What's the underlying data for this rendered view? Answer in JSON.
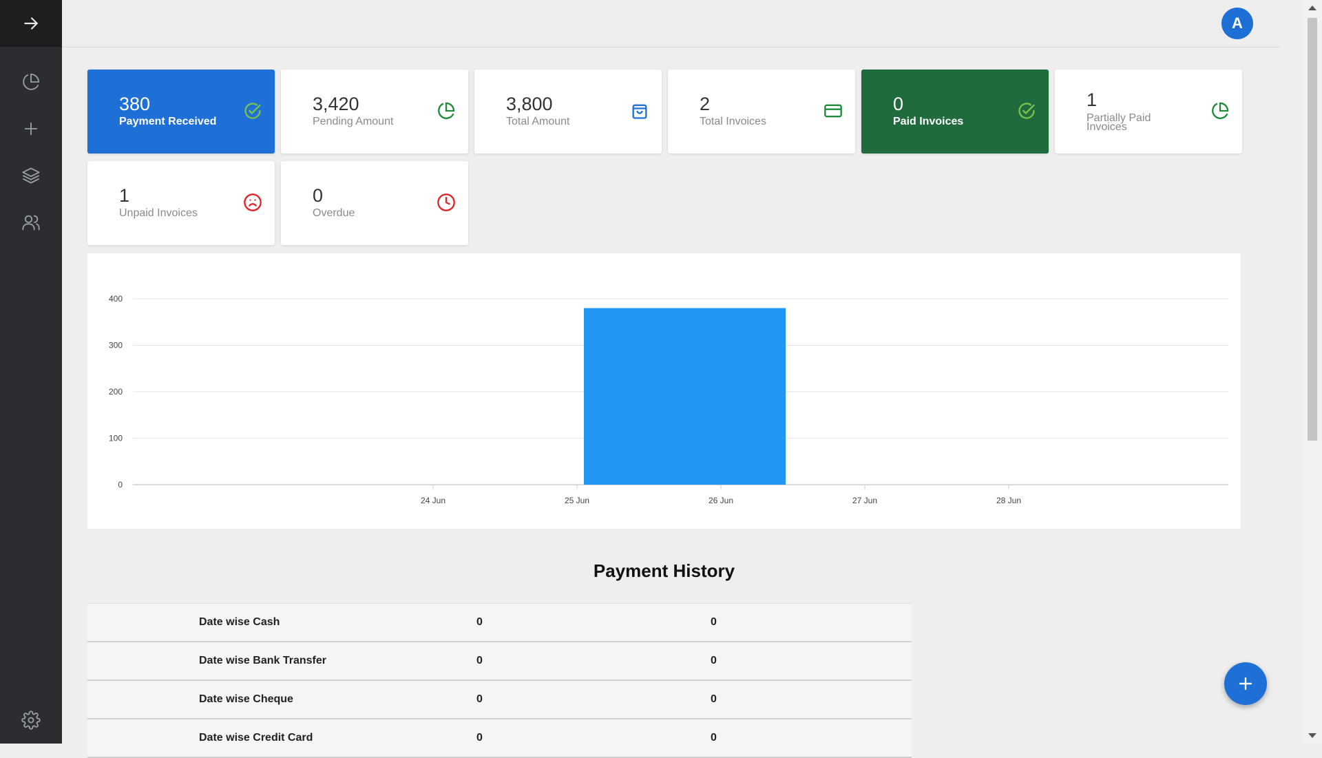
{
  "user": {
    "avatar_initial": "A"
  },
  "sidebar": {
    "items": [
      {
        "name": "toggle",
        "icon": "arrow-right-icon"
      },
      {
        "name": "reports",
        "icon": "pie-chart-icon"
      },
      {
        "name": "add",
        "icon": "plus-icon"
      },
      {
        "name": "layers",
        "icon": "layers-icon"
      },
      {
        "name": "users",
        "icon": "users-icon"
      },
      {
        "name": "settings",
        "icon": "gear-icon"
      }
    ]
  },
  "cards": [
    {
      "value": "380",
      "label": "Payment Received",
      "icon": "check-circle-icon",
      "style": "blue"
    },
    {
      "value": "3,420",
      "label": "Pending Amount",
      "icon": "pie-chart-icon",
      "style": "white"
    },
    {
      "value": "3,800",
      "label": "Total Amount",
      "icon": "shopping-bag-icon",
      "style": "white"
    },
    {
      "value": "2",
      "label": "Total Invoices",
      "icon": "credit-card-icon",
      "style": "white"
    },
    {
      "value": "0",
      "label": "Paid Invoices",
      "icon": "check-circle-icon",
      "style": "green"
    },
    {
      "value": "1",
      "label": "Partially Paid Invoices",
      "icon": "pie-chart-icon",
      "style": "white"
    },
    {
      "value": "1",
      "label": "Unpaid Invoices",
      "icon": "frown-icon",
      "style": "white"
    },
    {
      "value": "0",
      "label": "Overdue",
      "icon": "clock-icon",
      "style": "white"
    }
  ],
  "colors": {
    "primary": "#1e6fd6",
    "paid_green": "#1f6b3e",
    "icon_green": "#1e8a3a",
    "icon_light_green": "#7cc14b",
    "icon_red": "#e0242a",
    "bar_blue": "#2196f3"
  },
  "chart_data": {
    "type": "bar",
    "categories": [
      "24 Jun",
      "25 Jun",
      "26 Jun",
      "27 Jun",
      "28 Jun"
    ],
    "x_ticks": [
      "24 Jun",
      "25 Jun",
      "26 Jun",
      "27 Jun",
      "28 Jun"
    ],
    "y_ticks": [
      0,
      100,
      200,
      300,
      400
    ],
    "bars": [
      {
        "from": "25 Jun",
        "to": "26 Jun",
        "value": 380
      }
    ],
    "ylim": [
      0,
      400
    ],
    "grid": true,
    "title": "",
    "xlabel": "",
    "ylabel": ""
  },
  "payment_history": {
    "title": "Payment History",
    "rows": [
      {
        "label": "Date wise Cash",
        "a": "0",
        "b": "0"
      },
      {
        "label": "Date wise Bank Transfer",
        "a": "0",
        "b": "0"
      },
      {
        "label": "Date wise Cheque",
        "a": "0",
        "b": "0"
      },
      {
        "label": "Date wise Credit Card",
        "a": "0",
        "b": "0"
      }
    ]
  },
  "fab": {
    "icon": "plus-icon"
  }
}
